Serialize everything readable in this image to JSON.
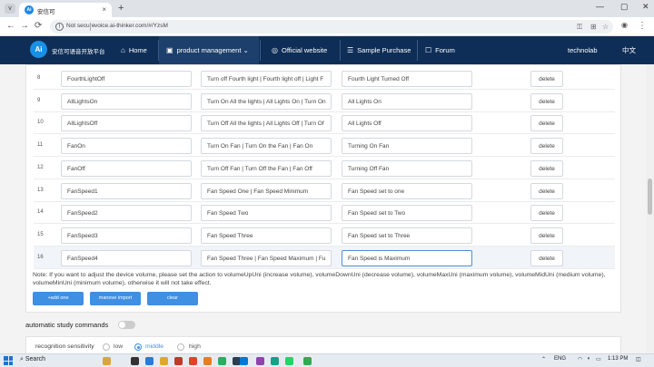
{
  "browser": {
    "mini_label": "v",
    "tab_title": "安信可",
    "tab_close": "×",
    "new_tab": "+",
    "win_min": "—",
    "win_max": "▢",
    "win_close": "✕",
    "not_secure": "Not secure",
    "url": "voice.ai-thinker.com/#/YzsM",
    "back": "←",
    "forward": "→",
    "reload": "⟳",
    "menu": "⋮"
  },
  "site": {
    "brand": "安信可语音开放平台",
    "nav": [
      {
        "icon": "⌂",
        "label": "Home"
      },
      {
        "icon": "▣",
        "label": "product management",
        "caret": "⌄"
      },
      {
        "icon": "◎",
        "label": "Official website"
      },
      {
        "icon": "☰",
        "label": "Sample Purchase"
      },
      {
        "icon": "☐",
        "label": "Forum"
      }
    ],
    "user": "technolab",
    "lang": "中文"
  },
  "table": {
    "rows": [
      {
        "num": "8",
        "action": "FourthLightOff",
        "phrase": "Turn off Fourth light | Fourth light off | Light F",
        "reply": "Fourth Light Turned Off",
        "del": "delete"
      },
      {
        "num": "9",
        "action": "AllLightsOn",
        "phrase": "Turn On All the lights | All Lights On | Turn On",
        "reply": "All Lights On",
        "del": "delete"
      },
      {
        "num": "10",
        "action": "AllLightsOff",
        "phrase": "Turn Off All the lights | All Lights Off | Turn Of",
        "reply": "All Lights Off",
        "del": "delete"
      },
      {
        "num": "11",
        "action": "FanOn",
        "phrase": "Turn On Fan | Turn On the Fan | Fan On",
        "reply": "Turning On Fan",
        "del": "delete"
      },
      {
        "num": "12",
        "action": "FanOff",
        "phrase": "Turn Off Fan | Turn Off the Fan | Fan Off",
        "reply": "Turning Off Fan",
        "del": "delete"
      },
      {
        "num": "13",
        "action": "FanSpeed1",
        "phrase": "Fan Speed One | Fan Speed Minimum",
        "reply": "Fan Speed set to one",
        "del": "delete"
      },
      {
        "num": "14",
        "action": "FanSpeed2",
        "phrase": "Fan Speed Two",
        "reply": "Fan Speed set to Two",
        "del": "delete"
      },
      {
        "num": "15",
        "action": "FanSpeed3",
        "phrase": "Fan Speed Three",
        "reply": "Fan Speed set to Three",
        "del": "delete"
      },
      {
        "num": "16",
        "action": "FanSpeed4",
        "phrase": "Fan Speed Three | Fan Speed Maximum | Fu",
        "reply": "Fan Speed is Maximum",
        "del": "delete"
      }
    ]
  },
  "note": "Note: If you want to adjust the device volume, please set the action to volumeUpUni (increase volume), volumeDownUni (decrease volume), volumeMaxUni (maximum volume), volumeMidUni (medium volume), volumeMinUni (minimum volume), otherwise it will not take effect.",
  "buttons": {
    "add": "+add one",
    "import": "manove import",
    "clear": "clear"
  },
  "auto_study": "automatic study commands",
  "sensitivity": {
    "label": "recognition sensitivity",
    "options": [
      "low",
      "middle",
      "high"
    ],
    "selected": "middle"
  },
  "taskbar": {
    "search": "Search",
    "time": "1:13 PM",
    "lang": "ENG"
  },
  "colors": {
    "nav_bg": "#0e2e57",
    "accent": "#3f8fe3"
  }
}
